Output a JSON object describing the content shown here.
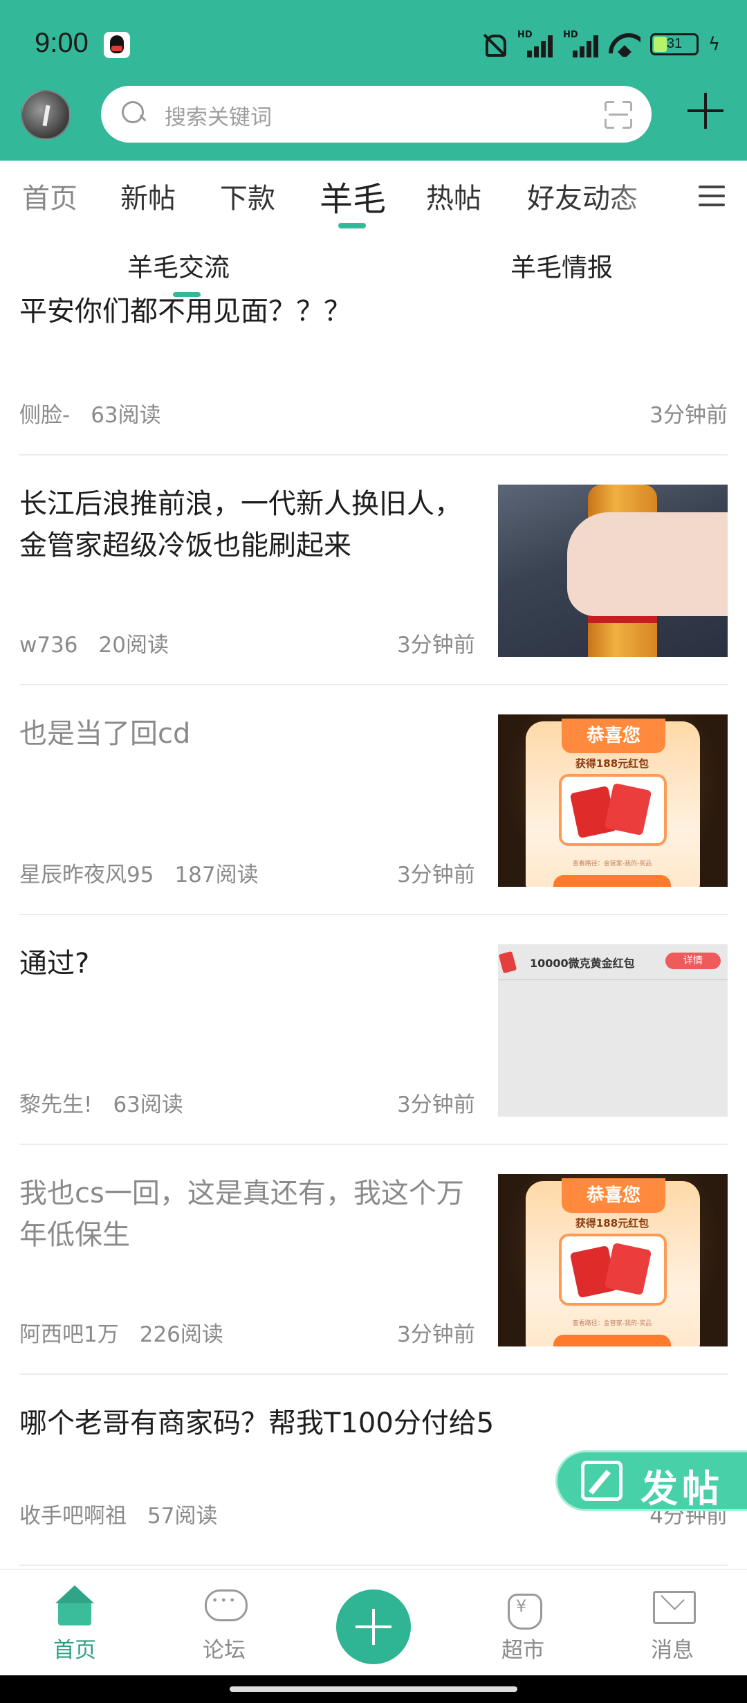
{
  "status_bar": {
    "time": "9:00",
    "battery": "31",
    "battery_level": 0.31
  },
  "header": {
    "search_placeholder": "搜索关键词"
  },
  "tabs": [
    {
      "label": "首页"
    },
    {
      "label": "新帖"
    },
    {
      "label": "下款"
    },
    {
      "label": "羊毛",
      "active": true
    },
    {
      "label": "热帖"
    },
    {
      "label": "好友动态"
    }
  ],
  "subtabs": [
    {
      "label": "羊毛交流",
      "active": true
    },
    {
      "label": "羊毛情报"
    }
  ],
  "posts": [
    {
      "title": "平安你们都不用见面？？？",
      "author": "侧脸-",
      "reads": "63阅读",
      "time": "3分钟前",
      "read": false
    },
    {
      "title": "长江后浪推前浪，一代新人换旧人，金管家超级冷饭也能刷起来",
      "author": "w736",
      "reads": "20阅读",
      "time": "3分钟前",
      "read": false
    },
    {
      "title": "也是当了回cd",
      "author": "星辰昨夜风95",
      "reads": "187阅读",
      "time": "3分钟前",
      "read": true
    },
    {
      "title": "通过?",
      "author": "黎先生!",
      "reads": "63阅读",
      "time": "3分钟前",
      "read": false
    },
    {
      "title": "我也cs一回，这是真还有，我这个万年低保生",
      "author": "阿西吧1万",
      "reads": "226阅读",
      "time": "3分钟前",
      "read": true
    },
    {
      "title": "哪个老哥有商家码？帮我T100分付给5",
      "author": "收手吧啊祖",
      "reads": "57阅读",
      "time": "4分钟前",
      "read": false
    }
  ],
  "thumbs": {
    "redpack_banner": "恭喜您",
    "redpack_sub": "获得188元红包",
    "redpack_foot": "查看路径：金管家-我的-奖品",
    "gray_text": "10000微克黄金红包",
    "gray_pill": "详情"
  },
  "fab": {
    "label": "发帖"
  },
  "bottom_nav": [
    {
      "label": "首页",
      "active": true
    },
    {
      "label": "论坛"
    },
    {
      "label": "超市"
    },
    {
      "label": "消息"
    }
  ],
  "colors": {
    "brand": "#33b99a",
    "accent": "#2f9e86"
  }
}
